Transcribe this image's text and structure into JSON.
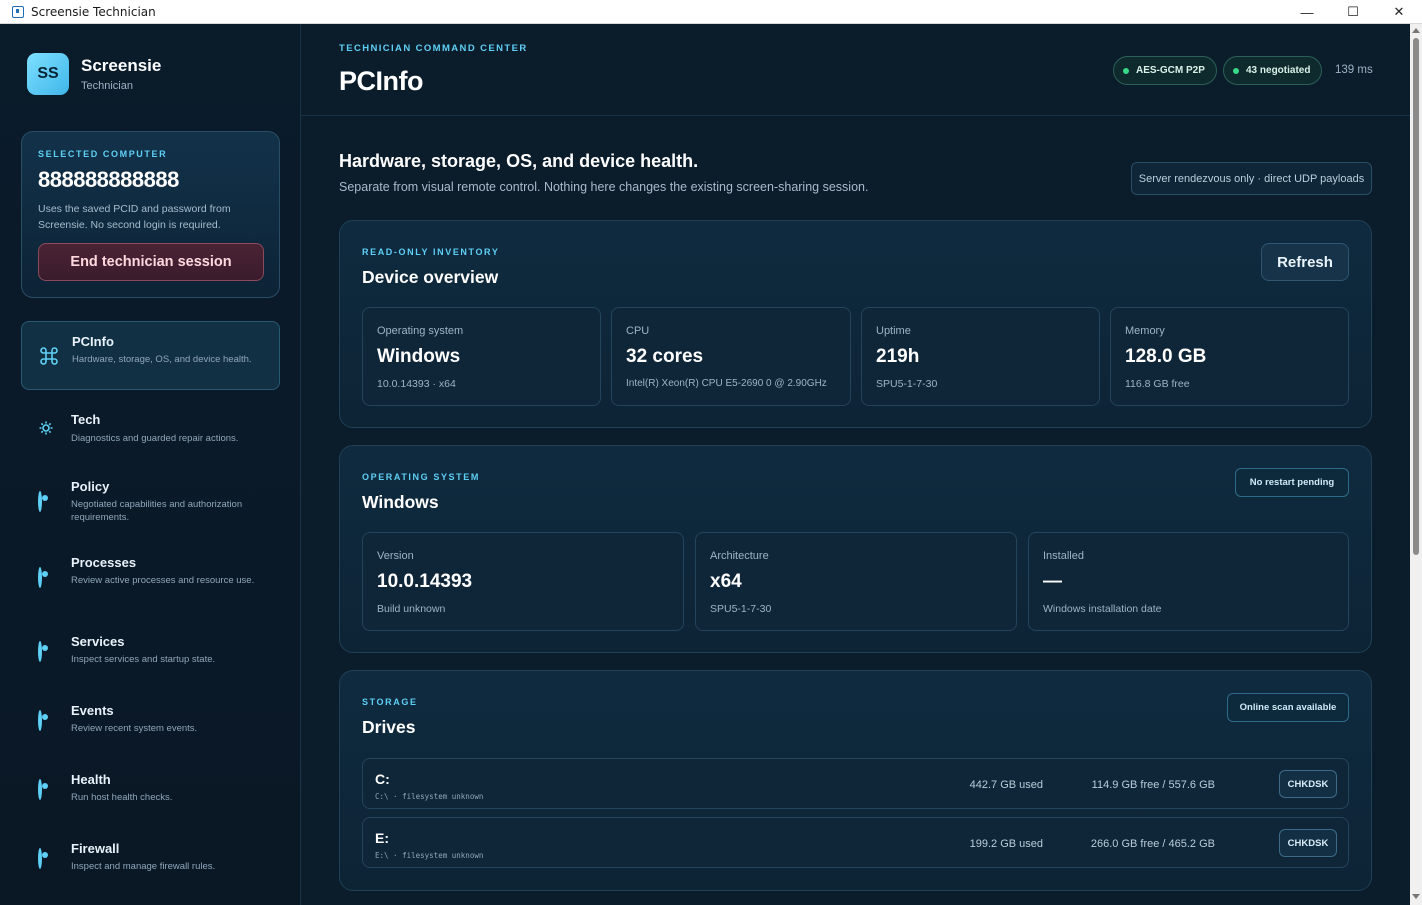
{
  "window": {
    "title": "Screensie Technician",
    "controls": {
      "minimize": "—",
      "maximize": "☐",
      "close": "✕"
    }
  },
  "brand": {
    "logo": "SS",
    "name": "Screensie",
    "role": "Technician"
  },
  "selected": {
    "eyebrow": "SELECTED COMPUTER",
    "id": "888888888888",
    "description": "Uses the saved PCID and password from Screensie. No second login is required.",
    "end_label": "End technician session"
  },
  "nav": [
    {
      "title": "PCInfo",
      "sub": "Hardware, storage, OS, and device health.",
      "icon": "command-icon"
    },
    {
      "title": "Tech",
      "sub": "Diagnostics and guarded repair actions.",
      "icon": "gear-icon"
    },
    {
      "title": "Policy",
      "sub": "Negotiated capabilities and authorization requirements.",
      "icon": "radio-dot-icon"
    },
    {
      "title": "Processes",
      "sub": "Review active processes and resource use.",
      "icon": "radio-dot-icon"
    },
    {
      "title": "Services",
      "sub": "Inspect services and startup state.",
      "icon": "radio-dot-icon"
    },
    {
      "title": "Events",
      "sub": "Review recent system events.",
      "icon": "radio-dot-icon"
    },
    {
      "title": "Health",
      "sub": "Run host health checks.",
      "icon": "radio-dot-icon"
    },
    {
      "title": "Firewall",
      "sub": "Inspect and manage firewall rules.",
      "icon": "radio-dot-icon"
    }
  ],
  "header": {
    "eyebrow": "TECHNICIAN COMMAND CENTER",
    "title": "PCInfo",
    "pills": [
      "AES-GCM P2P",
      "43 negotiated"
    ],
    "latency": "139 ms"
  },
  "section": {
    "title": "Hardware, storage, OS, and device health.",
    "subtitle": "Separate from visual remote control. Nothing here changes the existing screen-sharing session.",
    "rendezvous": "Server rendezvous only · direct UDP payloads"
  },
  "overview": {
    "eyebrow": "READ-ONLY INVENTORY",
    "title": "Device overview",
    "refresh_label": "Refresh",
    "stats": [
      {
        "label": "Operating system",
        "value": "Windows",
        "sub": "10.0.14393 · x64"
      },
      {
        "label": "CPU",
        "value": "32 cores",
        "sub": "Intel(R) Xeon(R) CPU E5-2690 0 @ 2.90GHz"
      },
      {
        "label": "Uptime",
        "value": "219h",
        "sub": "SPU5-1-7-30"
      },
      {
        "label": "Memory",
        "value": "128.0 GB",
        "sub": "116.8 GB free"
      }
    ]
  },
  "os": {
    "eyebrow": "OPERATING SYSTEM",
    "title": "Windows",
    "status": "No restart pending",
    "stats": [
      {
        "label": "Version",
        "value": "10.0.14393",
        "sub": "Build unknown"
      },
      {
        "label": "Architecture",
        "value": "x64",
        "sub": "SPU5-1-7-30"
      },
      {
        "label": "Installed",
        "value": "—",
        "sub": "Windows installation date"
      }
    ]
  },
  "storage": {
    "eyebrow": "STORAGE",
    "title": "Drives",
    "status": "Online scan available",
    "drives": [
      {
        "letter": "C:",
        "meta": "C:\\ · filesystem unknown",
        "used": "442.7 GB used",
        "free": "114.9 GB free / 557.6 GB",
        "action": "CHKDSK"
      },
      {
        "letter": "E:",
        "meta": "E:\\ · filesystem unknown",
        "used": "199.2 GB used",
        "free": "266.0 GB free / 465.2 GB",
        "action": "CHKDSK"
      }
    ]
  }
}
